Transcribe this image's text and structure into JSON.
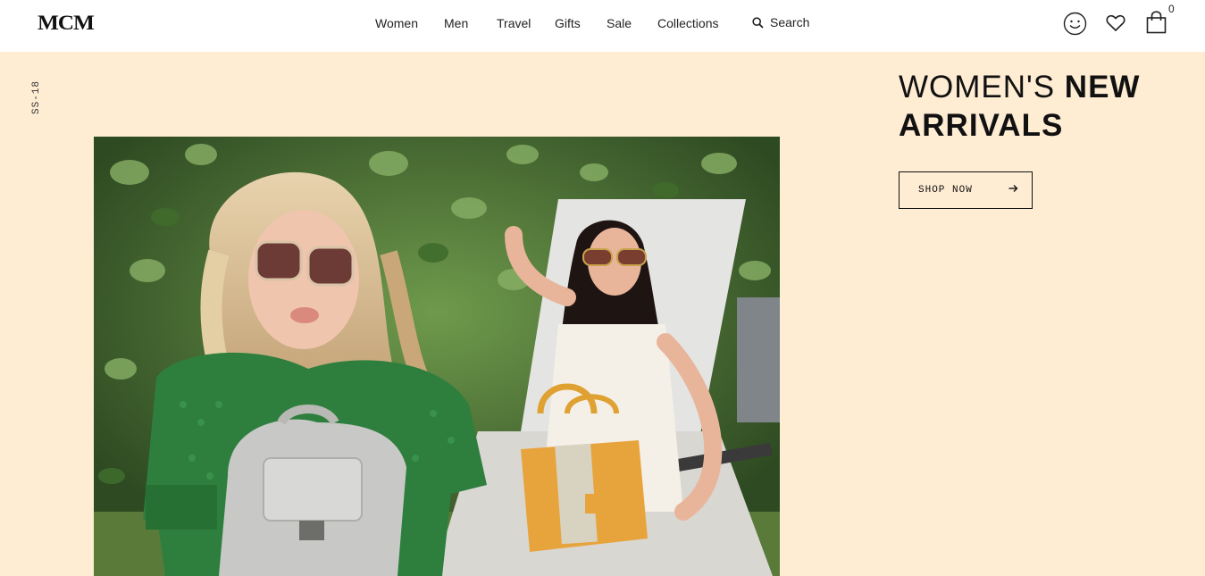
{
  "brand": {
    "logo": "MCM"
  },
  "nav": {
    "items": [
      {
        "label": "Women"
      },
      {
        "label": "Men"
      },
      {
        "label": "Travel"
      },
      {
        "label": "Gifts"
      },
      {
        "label": "Sale"
      },
      {
        "label": "Collections"
      }
    ],
    "search_label": "Search"
  },
  "header_icons": {
    "account": "smiley-icon",
    "wishlist": "heart-icon",
    "cart": "shopping-bag-icon",
    "cart_count": "0"
  },
  "hero": {
    "season": "SS-18",
    "headline_light": "WOMEN'S ",
    "headline_bold_1": "NEW",
    "headline_bold_2": "ARRIVALS",
    "cta_label": "SHOP NOW",
    "background_color": "#feecd3"
  }
}
